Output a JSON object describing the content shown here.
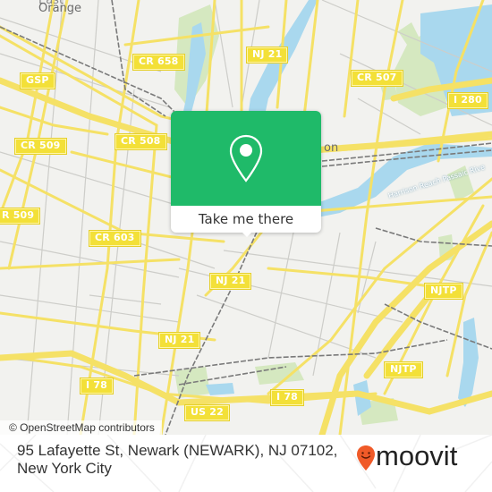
{
  "map": {
    "colors": {
      "land": "#f2f2ef",
      "water": "#a9d8ee",
      "park": "#d5e8c0",
      "major_road": "#f5e166",
      "minor_road": "#c9c9c9",
      "rail": "#7a7a7a",
      "shield": "#f3e038"
    },
    "place_labels": [
      {
        "id": "east-orange",
        "text": "Orange",
        "partial_top": "East"
      },
      {
        "id": "harrison-partial",
        "text": "on"
      }
    ],
    "river_label": "Harrison Reach Passaic Rive",
    "route_shields": [
      {
        "id": "cr658",
        "text": "CR 658"
      },
      {
        "id": "nj21-north",
        "text": "NJ 21"
      },
      {
        "id": "cr507",
        "text": "CR 507"
      },
      {
        "id": "gsp",
        "text": "GSP"
      },
      {
        "id": "i280",
        "text": "I 280"
      },
      {
        "id": "cr509-a",
        "text": "CR 509"
      },
      {
        "id": "cr508",
        "text": "CR 508"
      },
      {
        "id": "cr509-b",
        "text": "R 509"
      },
      {
        "id": "cr603",
        "text": "CR 603"
      },
      {
        "id": "nj21-mid",
        "text": "NJ 21"
      },
      {
        "id": "njtp-a",
        "text": "NJTP"
      },
      {
        "id": "nj21-south",
        "text": "NJ 21"
      },
      {
        "id": "njtp-b",
        "text": "NJTP"
      },
      {
        "id": "i78-west",
        "text": "I 78"
      },
      {
        "id": "i78-east",
        "text": "I 78"
      },
      {
        "id": "us22",
        "text": "US 22"
      }
    ],
    "attribution": "© OpenStreetMap contributors"
  },
  "popup": {
    "icon": "map-pin-icon",
    "cta_label": "Take me there",
    "color": "#1fba69"
  },
  "footer": {
    "address": "95 Lafayette St, Newark (NEWARK), NJ 07102, New York City",
    "logo_text": "moovit",
    "logo_icon": "moovit-pin-smile-icon",
    "logo_color": "#f05a28"
  }
}
